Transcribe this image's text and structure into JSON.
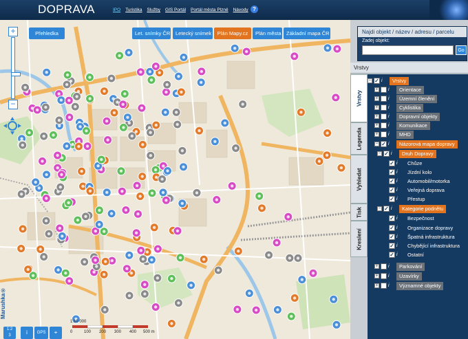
{
  "header": {
    "title": "DOPRAVA",
    "nav": [
      "IPO",
      "Turistika",
      "Služby",
      "GIS Portál",
      "Portál města Plzně",
      "Návody"
    ],
    "help": "?"
  },
  "map": {
    "overview_button": "Přehledka",
    "basemaps": [
      {
        "label": "Let. snímky ČR",
        "active": false
      },
      {
        "label": "Letecký snímek",
        "active": false
      },
      {
        "label": "Plán Mapy.cz",
        "active": true
      },
      {
        "label": "Plán města",
        "active": false
      },
      {
        "label": "Základní mapa ČR",
        "active": false
      }
    ],
    "zoom_in": "+",
    "zoom_out": "−",
    "zoom_level": 0.6,
    "gps_label": "GPS",
    "info_label": "i",
    "scale_ratio": "1:10 000",
    "scale_ticks": [
      "0",
      "100",
      "200",
      "300",
      "400",
      "500 m"
    ],
    "logo": "Marushka®"
  },
  "panel": {
    "search_title": "Najdi objekt / název / adresu / parcelu",
    "search_label": "Zadej objekt:",
    "search_value": "",
    "go": "Go",
    "layers_title": "Vrstvy",
    "tabs": [
      "Vrstvy",
      "Legenda",
      "Vyhledat",
      "Tisk",
      "Kreslení"
    ],
    "tree": [
      {
        "label": "Vrstvy",
        "level": 0,
        "checked": true,
        "expanded": true,
        "style": "orange"
      },
      {
        "label": "Orientace",
        "level": 1,
        "checked": false,
        "expanded": false,
        "style": "grey"
      },
      {
        "label": "Územní členění",
        "level": 1,
        "checked": false,
        "expanded": false,
        "style": "grey"
      },
      {
        "label": "Cyklistika",
        "level": 1,
        "checked": false,
        "expanded": false,
        "style": "grey"
      },
      {
        "label": "Dopravní objekty",
        "level": 1,
        "checked": false,
        "expanded": false,
        "style": "grey"
      },
      {
        "label": "Komunikace",
        "level": 1,
        "checked": false,
        "expanded": false,
        "style": "grey"
      },
      {
        "label": "MHD",
        "level": 1,
        "checked": false,
        "expanded": false,
        "style": "grey"
      },
      {
        "label": "Názorová mapa dopravy",
        "level": 1,
        "checked": true,
        "expanded": true,
        "style": "orange"
      },
      {
        "label": "Druh Dopravy",
        "level": 2,
        "checked": true,
        "expanded": true,
        "style": "orange"
      },
      {
        "label": "Chůze",
        "level": 3,
        "checked": true,
        "style": "plain"
      },
      {
        "label": "Jízdní kolo",
        "level": 3,
        "checked": true,
        "style": "plain"
      },
      {
        "label": "Automobil/motorka",
        "level": 3,
        "checked": true,
        "style": "plain"
      },
      {
        "label": "Veřejná doprava",
        "level": 3,
        "checked": true,
        "style": "plain"
      },
      {
        "label": "Přestup",
        "level": 3,
        "checked": true,
        "style": "plain"
      },
      {
        "label": "Kategorie podnětu",
        "level": 2,
        "checked": true,
        "expanded": true,
        "style": "orange"
      },
      {
        "label": "Bezpečnost",
        "level": 3,
        "checked": true,
        "style": "plain"
      },
      {
        "label": "Organizace dopravy",
        "level": 3,
        "checked": true,
        "style": "plain"
      },
      {
        "label": "Špatná infrastruktura",
        "level": 3,
        "checked": true,
        "style": "plain"
      },
      {
        "label": "Chybějící infrastruktura",
        "level": 3,
        "checked": true,
        "style": "plain"
      },
      {
        "label": "Ostatní",
        "level": 3,
        "checked": true,
        "style": "plain"
      },
      {
        "label": "Parkování",
        "level": 1,
        "checked": false,
        "expanded": false,
        "style": "grey"
      },
      {
        "label": "Uzavírky",
        "level": 1,
        "checked": false,
        "expanded": false,
        "style": "grey"
      },
      {
        "label": "Významné objekty",
        "level": 1,
        "checked": false,
        "expanded": false,
        "style": "grey"
      }
    ]
  },
  "colors": {
    "header": "#1b3f66",
    "button": "#2f86d6",
    "active": "#e2731f",
    "marker_pink": "#d84bc4",
    "marker_blue": "#4a8fd8",
    "marker_green": "#5fbf5a",
    "marker_grey": "#8a8a8a",
    "marker_orange": "#e27a2a"
  }
}
